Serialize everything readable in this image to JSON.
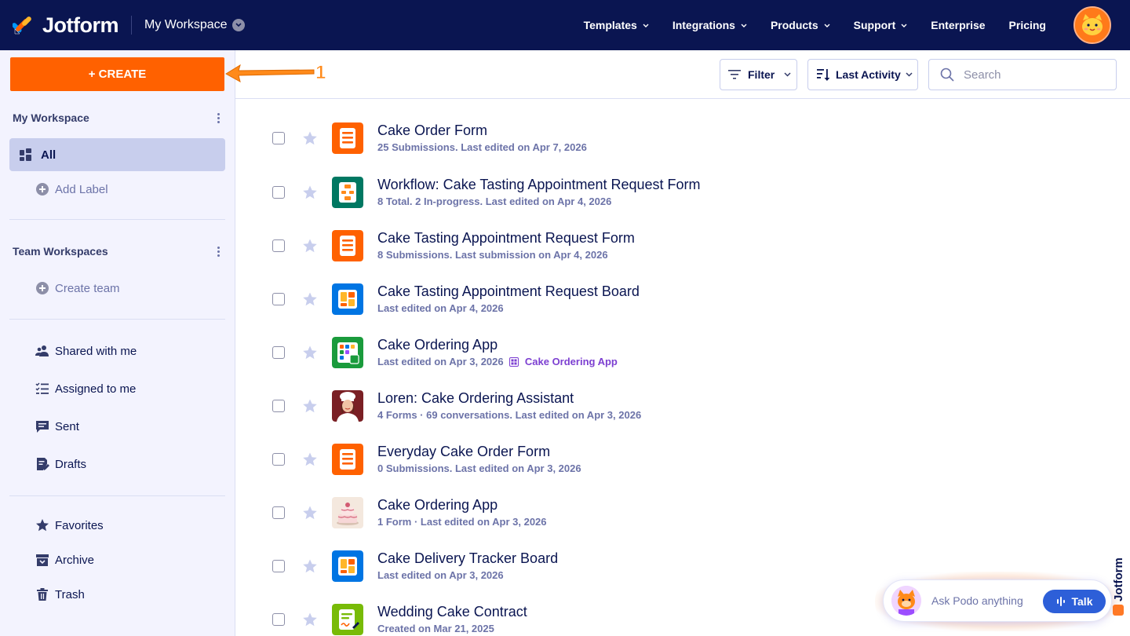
{
  "header": {
    "brand": "Jotform",
    "workspace_switch": "My Workspace",
    "nav": [
      "Templates",
      "Integrations",
      "Products",
      "Support",
      "Enterprise",
      "Pricing"
    ]
  },
  "sidebar": {
    "create_label": "+ CREATE",
    "my_workspace": "My Workspace",
    "all": "All",
    "add_label": "Add Label",
    "team_workspaces": "Team Workspaces",
    "create_team": "Create team",
    "shared": "Shared with me",
    "assigned": "Assigned to me",
    "sent": "Sent",
    "drafts": "Drafts",
    "favorites": "Favorites",
    "archive": "Archive",
    "trash": "Trash"
  },
  "annotation": {
    "label": "1"
  },
  "toolbar": {
    "filter": "Filter",
    "sort": "Last Activity",
    "search_placeholder": "Search"
  },
  "items": [
    {
      "title": "Cake Order Form",
      "meta": "25 Submissions. Last edited on Apr 7, 2026",
      "icon": "form-icon"
    },
    {
      "title": "Workflow: Cake Tasting Appointment Request Form",
      "meta": "8 Total. 2 In-progress. Last edited on Apr 4, 2026",
      "icon": "workflow-icon"
    },
    {
      "title": "Cake Tasting Appointment Request Form",
      "meta": "8 Submissions. Last submission on Apr 4, 2026",
      "icon": "form-icon"
    },
    {
      "title": "Cake Tasting Appointment Request Board",
      "meta": "Last edited on Apr 4, 2026",
      "icon": "board-icon"
    },
    {
      "title": "Cake Ordering App",
      "meta": "Last edited on Apr 3, 2026",
      "link": "Cake Ordering App",
      "icon": "app-icon"
    },
    {
      "title": "Loren: Cake Ordering Assistant",
      "meta": "4 Forms · 69 conversations. Last edited on Apr 3, 2026",
      "icon": "agent-avatar-icon"
    },
    {
      "title": "Everyday Cake Order Form",
      "meta": "0 Submissions. Last edited on Apr 3, 2026",
      "icon": "form-icon"
    },
    {
      "title": "Cake Ordering App",
      "meta": "1 Form · Last edited on Apr 3, 2026",
      "icon": "cake-image-icon"
    },
    {
      "title": "Cake Delivery Tracker Board",
      "meta": "Last edited on Apr 3, 2026",
      "icon": "board-icon"
    },
    {
      "title": "Wedding Cake Contract",
      "meta": "Created on Mar 21, 2025",
      "icon": "sign-icon"
    }
  ],
  "podo": {
    "placeholder": "Ask Podo anything",
    "talk": "Talk"
  },
  "colors": {
    "navy": "#0a1551",
    "orange": "#ff6100",
    "sidebar_bg": "#f3f3fe",
    "active_bg": "#c8ceed",
    "blue": "#0075e3",
    "green": "#007862",
    "purple_link": "#7c3fd1",
    "talk_blue": "#2d5fd8"
  }
}
